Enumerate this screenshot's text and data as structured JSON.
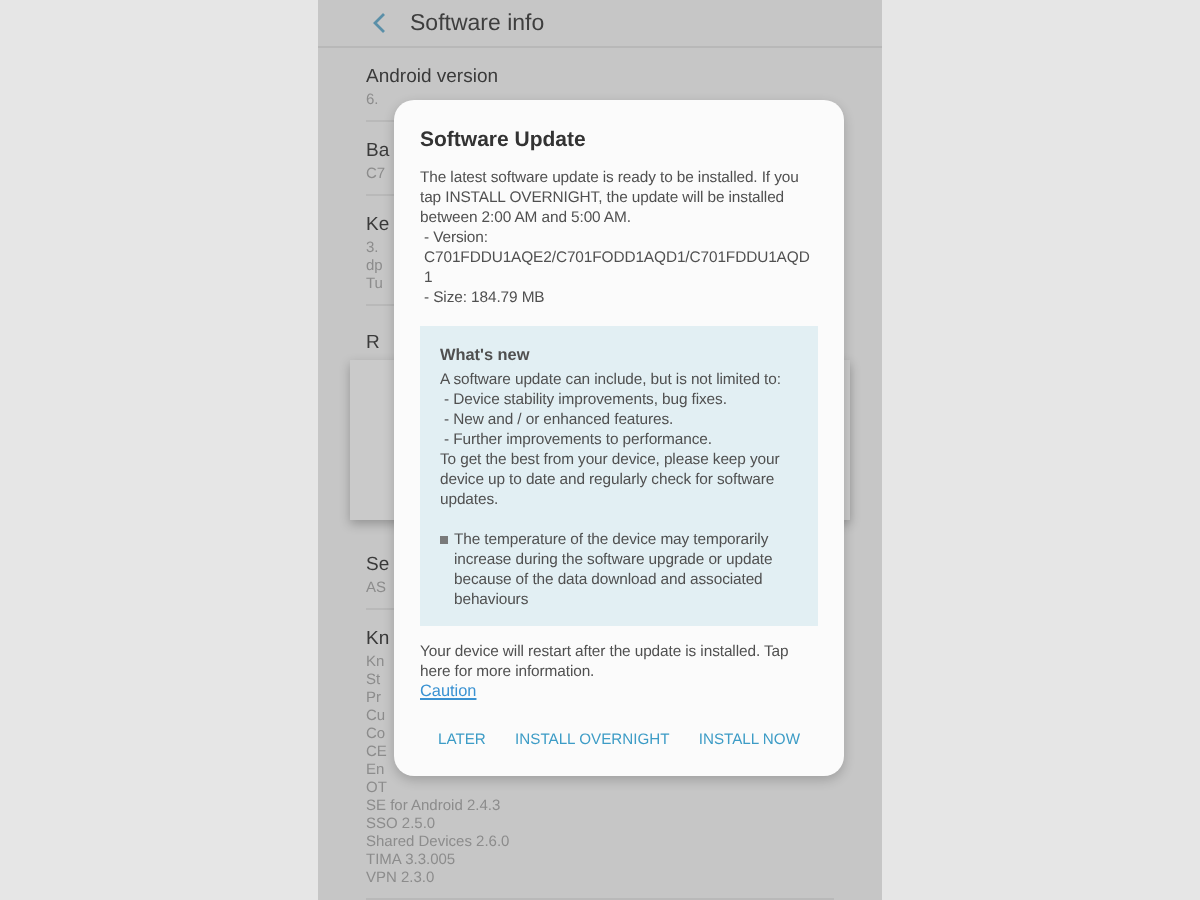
{
  "header": {
    "title": "Software info"
  },
  "background_rows": [
    {
      "title": "Android version",
      "lines": [
        "6."
      ]
    },
    {
      "title": "Ba",
      "lines": [
        "C7"
      ]
    },
    {
      "title": "Ke",
      "lines": [
        "3.",
        "dp",
        "Tu"
      ]
    },
    {
      "title": "R",
      "kind": "card"
    },
    {
      "title": "Se",
      "lines": [
        "AS"
      ]
    },
    {
      "title": "Kn",
      "lines": [
        "Kn",
        "St",
        "Pr",
        "Cu",
        "Co",
        "CE",
        "En",
        "OT",
        "SE for Android 2.4.3",
        "SSO 2.5.0",
        "Shared Devices 2.6.0",
        "TIMA 3.3.005",
        "VPN 2.3.0"
      ]
    }
  ],
  "dialog": {
    "title": "Software Update",
    "intro": "The latest software update is ready to be installed. If you tap INSTALL OVERNIGHT, the update will be installed between 2:00 AM and 5:00 AM.",
    "details": [
      "- Version: C701FDDU1AQE2/C701FODD1AQD1/C701FDDU1AQD1",
      "- Size: 184.79 MB"
    ],
    "whats_new": {
      "heading": "What's new",
      "text": "A software update can include, but is not limited to:",
      "items": [
        "- Device stability improvements, bug fixes.",
        "- New and / or enhanced features.",
        "- Further improvements to performance."
      ],
      "advice": "To get the best from your device, please keep your device up to date and regularly check for software updates.",
      "note": "The temperature of the device may temporarily increase during the software upgrade or update because of the data download and associated behaviours"
    },
    "footer": "Your device will restart after the update is installed. Tap here for more information.",
    "link": "Caution",
    "buttons": [
      "LATER",
      "INSTALL OVERNIGHT",
      "INSTALL NOW"
    ]
  }
}
